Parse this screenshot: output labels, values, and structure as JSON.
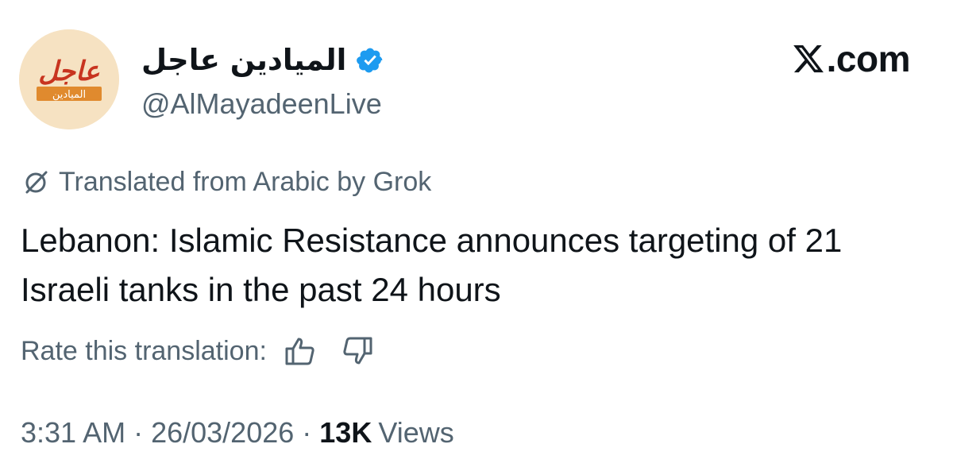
{
  "account": {
    "display_name": "الميادين عاجل",
    "handle": "@AlMayadeenLive",
    "avatar": {
      "main_text": "عاجل",
      "sub_text": "الميادين",
      "bg_color": "#f6e2c2",
      "text_color": "#c8341f",
      "band_color": "#e08a2e"
    },
    "verified_icon": "verified-badge-icon",
    "verified_color": "#1d9bf0"
  },
  "brand": {
    "icon": "x-logo-icon",
    "text": ".com"
  },
  "translation": {
    "icon": "grok-icon",
    "note": "Translated from Arabic by Grok"
  },
  "tweet": {
    "text": "Lebanon: Islamic Resistance announces targeting of 21 Israeli tanks in the past 24 hours"
  },
  "rating": {
    "label": "Rate this translation:",
    "thumbs_up_icon": "thumbs-up-icon",
    "thumbs_down_icon": "thumbs-down-icon"
  },
  "meta": {
    "time": "3:31 AM",
    "separator": "·",
    "date": "26/03/2026",
    "views_count": "13K",
    "views_label": "Views"
  },
  "colors": {
    "text_primary": "#0f1419",
    "text_secondary": "#536471"
  }
}
